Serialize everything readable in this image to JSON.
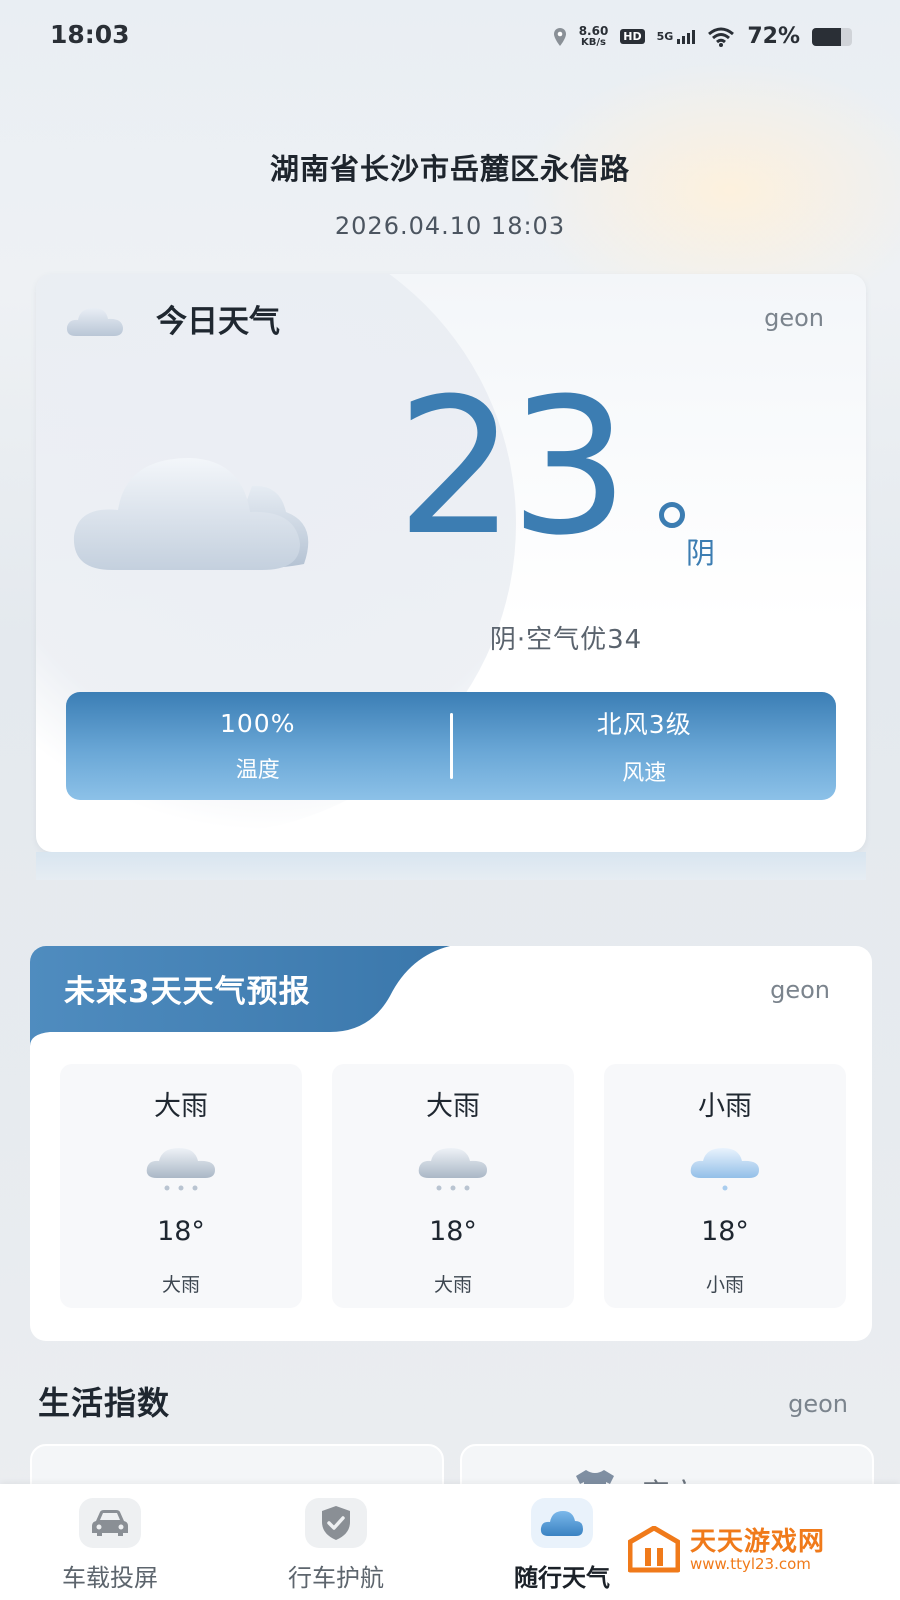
{
  "status_bar": {
    "time": "18:03",
    "net_speed_value": "8.60",
    "net_speed_unit": "KB/s",
    "hd": "HD",
    "network": "5G",
    "battery_percent": "72%",
    "battery_level": 0.72
  },
  "header": {
    "location": "湖南省长沙市岳麓区永信路",
    "datetime": "2026.04.10 18:03"
  },
  "today": {
    "title": "今日天气",
    "source": "geon",
    "temperature": "23",
    "condition": "阴",
    "summary": "阴·空气优34",
    "stats": [
      {
        "value": "100%",
        "label": "温度"
      },
      {
        "value": "北风3级",
        "label": "风速"
      }
    ]
  },
  "forecast": {
    "title": "未来3天天气预报",
    "source": "geon",
    "days": [
      {
        "condition": "大雨",
        "temp": "18°",
        "sub": "大雨",
        "icon": "rain-cloud-icon"
      },
      {
        "condition": "大雨",
        "temp": "18°",
        "sub": "大雨",
        "icon": "rain-cloud-icon"
      },
      {
        "condition": "小雨",
        "temp": "18°",
        "sub": "小雨",
        "icon": "light-rain-cloud-icon"
      }
    ]
  },
  "life_index": {
    "title": "生活指数",
    "source": "geon",
    "card2_label": "穿衣"
  },
  "bottom_nav": {
    "items": [
      {
        "label": "车载投屏",
        "icon": "car-icon",
        "active": false
      },
      {
        "label": "行车护航",
        "icon": "shield-check-icon",
        "active": false
      },
      {
        "label": "随行天气",
        "icon": "cloud-icon",
        "active": true
      }
    ]
  },
  "watermark": {
    "line1": "天天游戏网",
    "line2": "www.ttyl23.com"
  },
  "colors": {
    "accent": "#3c7db2",
    "stats_bar_top": "#3b7eb5",
    "stats_bar_bottom": "#8cc1e8",
    "watermark": "#f07a1a"
  }
}
